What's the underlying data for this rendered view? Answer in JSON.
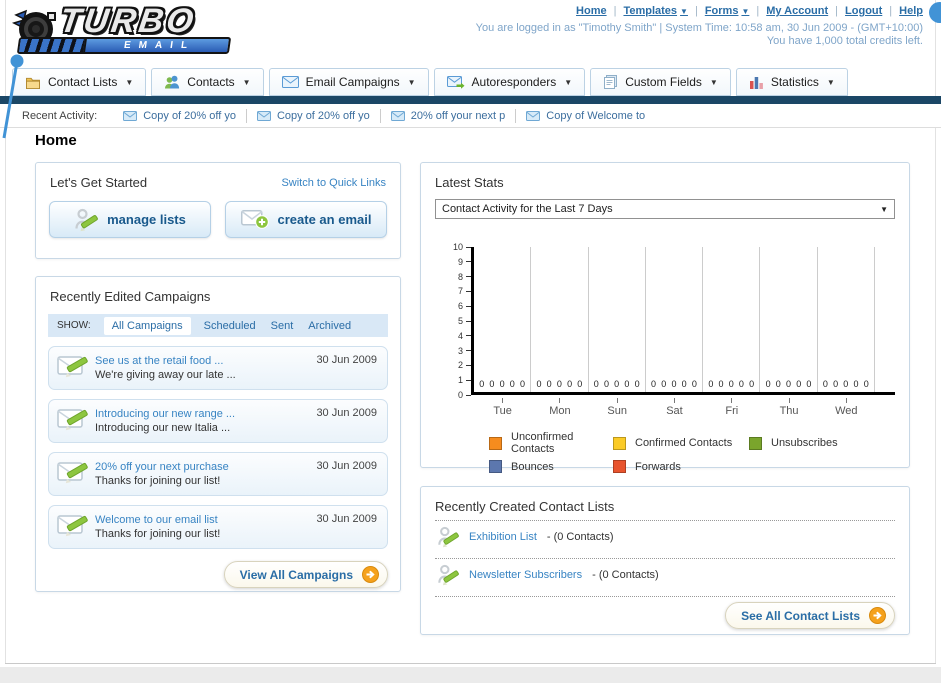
{
  "header": {
    "logo": {
      "title": "TURBO",
      "subtitle": "EMAIL"
    },
    "nav": [
      {
        "label": "Home",
        "dropdown": false
      },
      {
        "label": "Templates",
        "dropdown": true
      },
      {
        "label": "Forms",
        "dropdown": true
      },
      {
        "label": "My Account",
        "dropdown": false
      },
      {
        "label": "Logout",
        "dropdown": false
      },
      {
        "label": "Help",
        "dropdown": false
      }
    ],
    "login_info": "You are logged in as \"Timothy Smith\" | System Time: 10:58 am, 30 Jun 2009 - (GMT+10:00)",
    "credits_info": "You have 1,000 total credits left."
  },
  "menu_tabs": [
    {
      "label": "Contact Lists",
      "icon": "contact-lists-icon"
    },
    {
      "label": "Contacts",
      "icon": "contacts-icon"
    },
    {
      "label": "Email Campaigns",
      "icon": "email-campaigns-icon"
    },
    {
      "label": "Autoresponders",
      "icon": "autoresponders-icon"
    },
    {
      "label": "Custom Fields",
      "icon": "custom-fields-icon"
    },
    {
      "label": "Statistics",
      "icon": "statistics-icon"
    }
  ],
  "recent_activity": {
    "label": "Recent Activity:",
    "items": [
      "Copy of 20% off yo",
      "Copy of 20% off yo",
      "20% off your next p",
      "Copy of Welcome to"
    ]
  },
  "page_title": "Home",
  "get_started": {
    "title": "Let's Get Started",
    "switch_link": "Switch to Quick Links",
    "manage_lists_button": "manage lists",
    "create_email_button": "create an email"
  },
  "campaigns": {
    "title": "Recently Edited Campaigns",
    "show_label": "SHOW:",
    "filters": [
      "All Campaigns",
      "Scheduled",
      "Sent",
      "Archived"
    ],
    "active_filter": "All Campaigns",
    "items": [
      {
        "title": "See us at the retail food ...",
        "subtitle": "We're giving away our late ...",
        "date": "30 Jun 2009"
      },
      {
        "title": "Introducing our new range ...",
        "subtitle": "Introducing our new Italia ...",
        "date": "30 Jun 2009"
      },
      {
        "title": "20% off your next purchase",
        "subtitle": "Thanks for joining our list!",
        "date": "30 Jun 2009"
      },
      {
        "title": "Welcome to our email list",
        "subtitle": "Thanks for joining our list!",
        "date": "30 Jun 2009"
      }
    ],
    "view_all_button": "View All Campaigns"
  },
  "stats": {
    "title": "Latest Stats",
    "dropdown_value": "Contact Activity for the Last 7 Days"
  },
  "chart_data": {
    "type": "bar",
    "title": "Contact Activity for the Last 7 Days",
    "categories": [
      "Tue",
      "Mon",
      "Sun",
      "Sat",
      "Fri",
      "Thu",
      "Wed"
    ],
    "series": [
      {
        "name": "Unconfirmed Contacts",
        "color": "#F68C1E",
        "values": [
          0,
          0,
          0,
          0,
          0,
          0,
          0
        ]
      },
      {
        "name": "Confirmed Contacts",
        "color": "#FBCB27",
        "values": [
          0,
          0,
          0,
          0,
          0,
          0,
          0
        ]
      },
      {
        "name": "Unsubscribes",
        "color": "#7AA52C",
        "values": [
          0,
          0,
          0,
          0,
          0,
          0,
          0
        ]
      },
      {
        "name": "Bounces",
        "color": "#5C77AE",
        "values": [
          0,
          0,
          0,
          0,
          0,
          0,
          0
        ]
      },
      {
        "name": "Forwards",
        "color": "#E8542E",
        "values": [
          0,
          0,
          0,
          0,
          0,
          0,
          0
        ]
      }
    ],
    "ylim": [
      0,
      10
    ],
    "y_tick_step": 1,
    "data_labels": true,
    "grid": "vertical",
    "legend_position": "bottom"
  },
  "contact_lists": {
    "title": "Recently Created Contact Lists",
    "items": [
      {
        "name": "Exhibition List",
        "suffix": "- (0 Contacts)"
      },
      {
        "name": "Newsletter Subscribers",
        "suffix": "- (0 Contacts)"
      }
    ],
    "see_all_button": "See All Contact Lists"
  },
  "colors": {
    "navy_bar": "#1b4766",
    "link_blue": "#3884c3",
    "nav_link_blue": "#2a6da6",
    "muted_blue_text": "#7fa5c9",
    "filter_bar_bg": "#d9e8f6",
    "help_bubble": "#4193d6"
  }
}
